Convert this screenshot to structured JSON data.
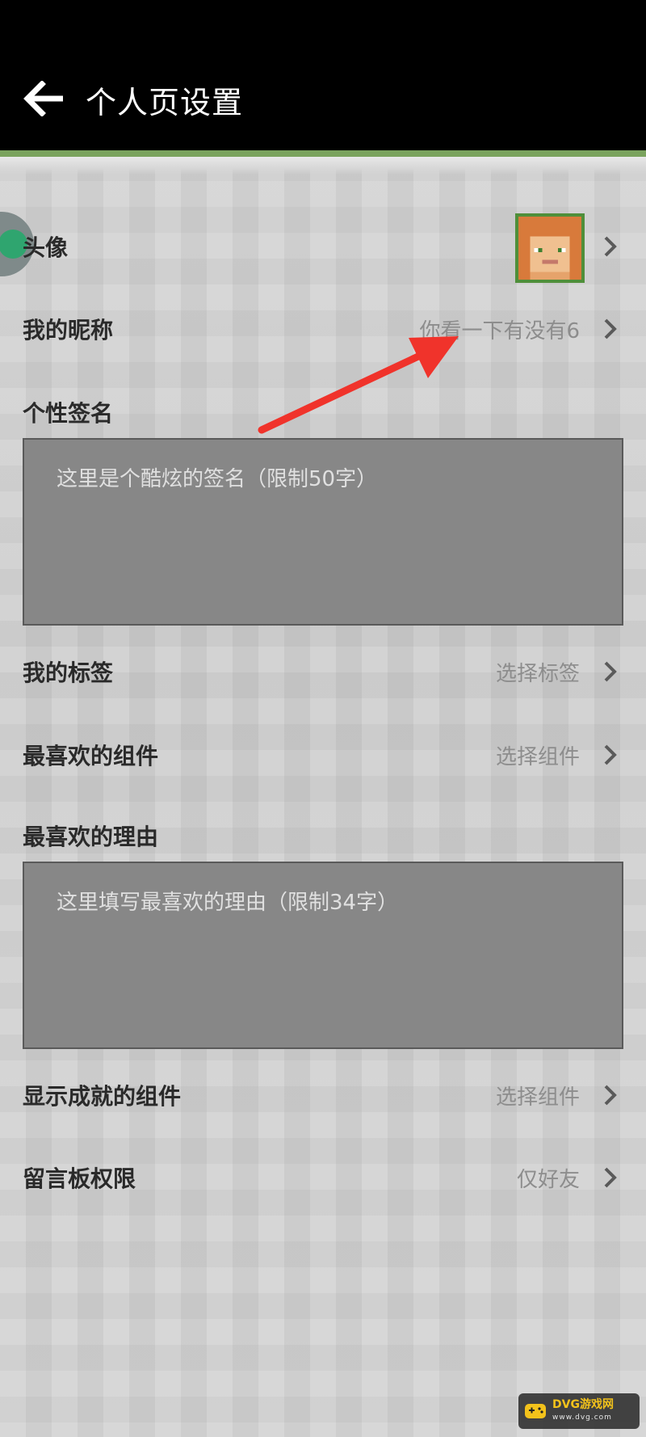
{
  "header": {
    "title": "个人页设置",
    "back_icon": "back-arrow-icon"
  },
  "rows": {
    "avatar": {
      "label": "头像"
    },
    "nickname": {
      "label": "我的昵称",
      "value": "你看一下有没有6"
    },
    "signature": {
      "label": "个性签名",
      "placeholder": "这里是个酷炫的签名（限制50字）"
    },
    "tags": {
      "label": "我的标签",
      "value": "选择标签"
    },
    "fav_component": {
      "label": "最喜欢的组件",
      "value": "选择组件"
    },
    "fav_reason": {
      "label": "最喜欢的理由",
      "placeholder": "这里填写最喜欢的理由（限制34字）"
    },
    "achievement_component": {
      "label": "显示成就的组件",
      "value": "选择组件"
    },
    "message_board": {
      "label": "留言板权限",
      "value": "仅好友"
    }
  },
  "watermark": {
    "text": "DVG游戏网",
    "subtext": "www.dvg.com"
  },
  "colors": {
    "header_bg": "#000000",
    "accent_green": "#7aa35d",
    "annotation_arrow": "#f0332b"
  }
}
